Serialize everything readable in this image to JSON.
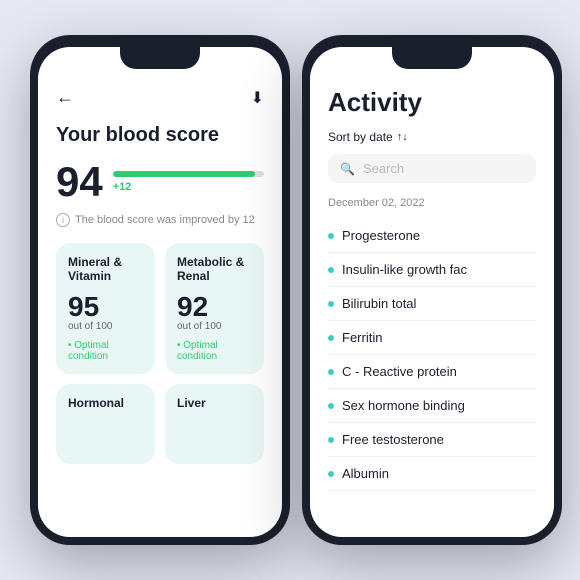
{
  "background_color": "#e8e8f5",
  "left_phone": {
    "top_bar": {
      "back_label": "←",
      "download_label": "⬇"
    },
    "title": "Your blood score",
    "score": "94",
    "score_bar_percent": 94,
    "score_delta": "+12",
    "info_text": "The blood score was improved by 12",
    "categories": [
      {
        "name": "Mineral &\nVitamin",
        "score": "95",
        "out_of": "out of 100",
        "status": "• Optimal condition"
      },
      {
        "name": "Metabolic &\nRenal",
        "score": "92",
        "out_of": "out of 100",
        "status": "• Optimal condition"
      },
      {
        "name": "Hormonal",
        "score": "",
        "out_of": "",
        "status": ""
      },
      {
        "name": "Liver",
        "score": "",
        "out_of": "",
        "status": ""
      }
    ]
  },
  "right_phone": {
    "title": "Activity",
    "sort_label": "Sort by date",
    "sort_icon": "↑↓",
    "search_placeholder": "Search",
    "date_label": "December 02, 2022",
    "items": [
      "Progesterone",
      "Insulin-like growth fac",
      "Bilirubin total",
      "Ferritin",
      "C - Reactive protein",
      "Sex hormone binding",
      "Free testosterone",
      "Albumin"
    ]
  }
}
